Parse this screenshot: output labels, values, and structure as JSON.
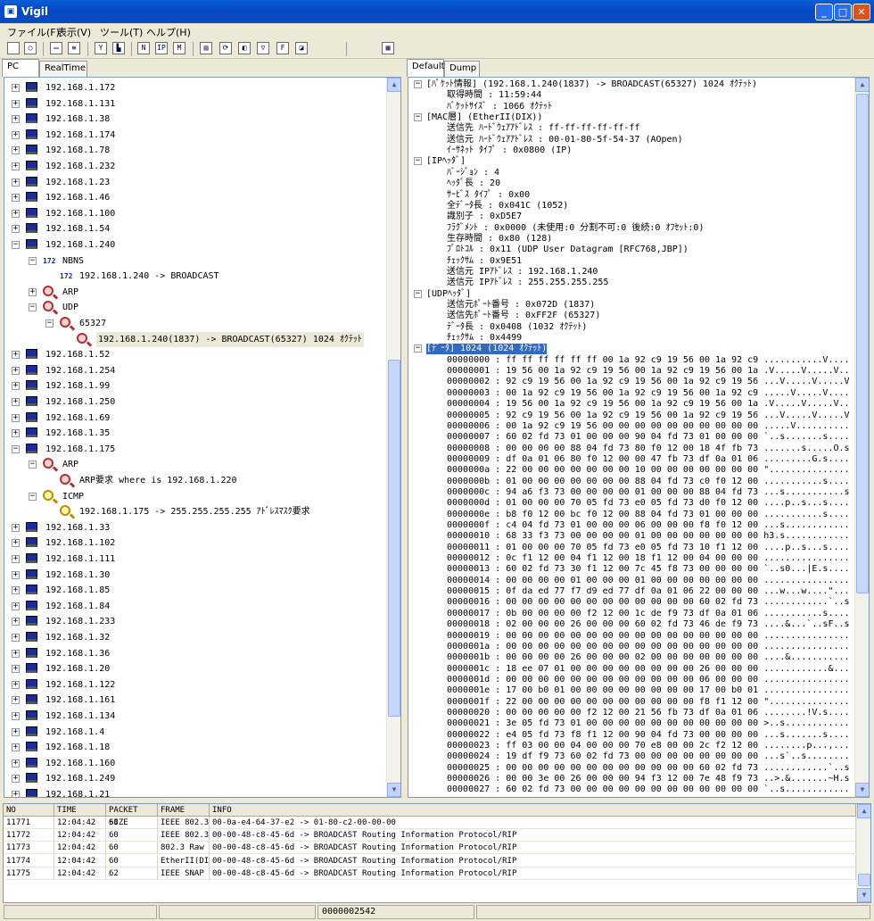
{
  "window": {
    "title": "Vigil",
    "app_icon": "computer-icon"
  },
  "menu": [
    "ファイル(F)",
    "表示(V)",
    "ツール(T)",
    "ヘルプ(H)"
  ],
  "left_tabs": [
    "PC",
    "RealTime"
  ],
  "right_tabs": [
    "Default",
    "Dump"
  ],
  "tree": [
    {
      "text": "192.168.1.172",
      "lv": 0,
      "t": "pc",
      "e": "+"
    },
    {
      "text": "192.168.1.131",
      "lv": 0,
      "t": "pc",
      "e": "+"
    },
    {
      "text": "192.168.1.38",
      "lv": 0,
      "t": "pc",
      "e": "+"
    },
    {
      "text": "192.168.1.174",
      "lv": 0,
      "t": "pc",
      "e": "+"
    },
    {
      "text": "192.168.1.78",
      "lv": 0,
      "t": "pc",
      "e": "+"
    },
    {
      "text": "192.168.1.232",
      "lv": 0,
      "t": "pc",
      "e": "+"
    },
    {
      "text": "192.168.1.23",
      "lv": 0,
      "t": "pc",
      "e": "+"
    },
    {
      "text": "192.168.1.46",
      "lv": 0,
      "t": "pc",
      "e": "+"
    },
    {
      "text": "192.168.1.100",
      "lv": 0,
      "t": "pc",
      "e": "+"
    },
    {
      "text": "192.168.1.54",
      "lv": 0,
      "t": "pc",
      "e": "+"
    },
    {
      "text": "192.168.1.240",
      "lv": 0,
      "t": "pc",
      "e": "-"
    },
    {
      "text": "NBNS",
      "lv": 1,
      "t": "nb",
      "e": "-"
    },
    {
      "text": "192.168.1.240 -> BROADCAST",
      "lv": 2,
      "t": "nb",
      "e": ""
    },
    {
      "text": "ARP",
      "lv": 1,
      "t": "mag",
      "e": "+"
    },
    {
      "text": "UDP",
      "lv": 1,
      "t": "mag",
      "e": "-"
    },
    {
      "text": "65327",
      "lv": 2,
      "t": "mag",
      "e": "-"
    },
    {
      "text": "192.168.1.240(1837) -> BROADCAST(65327) 1024 ｵｸﾃｯﾄ",
      "lv": 3,
      "t": "mag",
      "e": "",
      "sel": true
    },
    {
      "text": "192.168.1.52",
      "lv": 0,
      "t": "pc",
      "e": "+"
    },
    {
      "text": "192.168.1.254",
      "lv": 0,
      "t": "pc",
      "e": "+"
    },
    {
      "text": "192.168.1.99",
      "lv": 0,
      "t": "pc",
      "e": "+"
    },
    {
      "text": "192.168.1.250",
      "lv": 0,
      "t": "pc",
      "e": "+"
    },
    {
      "text": "192.168.1.69",
      "lv": 0,
      "t": "pc",
      "e": "+"
    },
    {
      "text": "192.168.1.35",
      "lv": 0,
      "t": "pc",
      "e": "+"
    },
    {
      "text": "192.168.1.175",
      "lv": 0,
      "t": "pc",
      "e": "-"
    },
    {
      "text": "ARP",
      "lv": 1,
      "t": "mag",
      "e": "-"
    },
    {
      "text": "ARP要求 where is 192.168.1.220",
      "lv": 2,
      "t": "mag",
      "e": ""
    },
    {
      "text": "ICMP",
      "lv": 1,
      "t": "magy",
      "e": "-"
    },
    {
      "text": "192.168.1.175 -> 255.255.255.255 ｱﾄﾞﾚｽﾏｽｸ要求",
      "lv": 2,
      "t": "magy",
      "e": ""
    },
    {
      "text": "192.168.1.33",
      "lv": 0,
      "t": "pc",
      "e": "+"
    },
    {
      "text": "192.168.1.102",
      "lv": 0,
      "t": "pc",
      "e": "+"
    },
    {
      "text": "192.168.1.111",
      "lv": 0,
      "t": "pc",
      "e": "+"
    },
    {
      "text": "192.168.1.30",
      "lv": 0,
      "t": "pc",
      "e": "+"
    },
    {
      "text": "192.168.1.85",
      "lv": 0,
      "t": "pc",
      "e": "+"
    },
    {
      "text": "192.168.1.84",
      "lv": 0,
      "t": "pc",
      "e": "+"
    },
    {
      "text": "192.168.1.233",
      "lv": 0,
      "t": "pc",
      "e": "+"
    },
    {
      "text": "192.168.1.32",
      "lv": 0,
      "t": "pc",
      "e": "+"
    },
    {
      "text": "192.168.1.36",
      "lv": 0,
      "t": "pc",
      "e": "+"
    },
    {
      "text": "192.168.1.20",
      "lv": 0,
      "t": "pc",
      "e": "+"
    },
    {
      "text": "192.168.1.122",
      "lv": 0,
      "t": "pc",
      "e": "+"
    },
    {
      "text": "192.168.1.161",
      "lv": 0,
      "t": "pc",
      "e": "+"
    },
    {
      "text": "192.168.1.134",
      "lv": 0,
      "t": "pc",
      "e": "+"
    },
    {
      "text": "192.168.1.4",
      "lv": 0,
      "t": "pc",
      "e": "+"
    },
    {
      "text": "192.168.1.18",
      "lv": 0,
      "t": "pc",
      "e": "+"
    },
    {
      "text": "192.168.1.160",
      "lv": 0,
      "t": "pc",
      "e": "+"
    },
    {
      "text": "192.168.1.249",
      "lv": 0,
      "t": "pc",
      "e": "+"
    },
    {
      "text": "192.168.1.21",
      "lv": 0,
      "t": "pc",
      "e": "+"
    }
  ],
  "detail": [
    {
      "text": "[ﾊﾟｹｯﾄ情報] (192.168.1.240(1837) -> BROADCAST(65327) 1024 ｵｸﾃｯﾄ)",
      "lv": 0,
      "e": "-"
    },
    {
      "text": "取得時間 : 11:59:44",
      "lv": 1,
      "e": ""
    },
    {
      "text": "ﾊﾟｹｯﾄｻｲｽﾞ : 1066 ｵｸﾃｯﾄ",
      "lv": 1,
      "e": ""
    },
    {
      "text": "[MAC層] (EtherII(DIX))",
      "lv": 0,
      "e": "-"
    },
    {
      "text": "送信先 ﾊｰﾄﾞｳｪｱｱﾄﾞﾚｽ : ff-ff-ff-ff-ff-ff",
      "lv": 1,
      "e": ""
    },
    {
      "text": "送信元 ﾊｰﾄﾞｳｪｱｱﾄﾞﾚｽ : 00-01-80-5f-54-37 (AOpen)",
      "lv": 1,
      "e": ""
    },
    {
      "text": "ｲｰｻﾈｯﾄ ﾀｲﾌﾟ : 0x0800 (IP)",
      "lv": 1,
      "e": ""
    },
    {
      "text": "[IPﾍｯﾀﾞ]",
      "lv": 0,
      "e": "-"
    },
    {
      "text": "ﾊﾞｰｼﾞｮﾝ : 4",
      "lv": 1,
      "e": ""
    },
    {
      "text": "ﾍｯﾀﾞ長 : 20",
      "lv": 1,
      "e": ""
    },
    {
      "text": "ｻｰﾋﾞｽ ﾀｲﾌﾟ : 0x00",
      "lv": 1,
      "e": ""
    },
    {
      "text": "全ﾃﾞｰﾀ長 : 0x041C (1052)",
      "lv": 1,
      "e": ""
    },
    {
      "text": "識別子 : 0xD5E7",
      "lv": 1,
      "e": ""
    },
    {
      "text": "ﾌﾗｸﾞﾒﾝﾄ : 0x0000 (未使用:0 分割不可:0 後続:0 ｵﾌｾｯﾄ:0)",
      "lv": 1,
      "e": ""
    },
    {
      "text": "生存時間 : 0x80 (128)",
      "lv": 1,
      "e": ""
    },
    {
      "text": "ﾌﾟﾛﾄｺﾙ : 0x11 (UDP User Datagram [RFC768,JBP])",
      "lv": 1,
      "e": ""
    },
    {
      "text": "ﾁｪｯｸｻﾑ : 0x9E51",
      "lv": 1,
      "e": ""
    },
    {
      "text": "送信元 IPｱﾄﾞﾚｽ : 192.168.1.240",
      "lv": 1,
      "e": ""
    },
    {
      "text": "送信元 IPｱﾄﾞﾚｽ : 255.255.255.255",
      "lv": 1,
      "e": ""
    },
    {
      "text": "[UDPﾍｯﾀﾞ]",
      "lv": 0,
      "e": "-"
    },
    {
      "text": "送信元ﾎﾟｰﾄ番号 : 0x072D (1837)",
      "lv": 1,
      "e": ""
    },
    {
      "text": "送信先ﾎﾟｰﾄ番号 : 0xFF2F (65327)",
      "lv": 1,
      "e": ""
    },
    {
      "text": "ﾃﾞｰﾀ長 : 0x0408 (1032 ｵｸﾃｯﾄ)",
      "lv": 1,
      "e": ""
    },
    {
      "text": "ﾁｪｯｸｻﾑ : 0x4499",
      "lv": 1,
      "e": ""
    },
    {
      "text": "[ﾃﾞｰﾀ] 1024 (1024 ｵｸﾃｯﾄ)",
      "lv": 0,
      "e": "-",
      "sel": true
    },
    {
      "text": "00000000 : ff ff ff ff ff ff 00 1a 92 c9 19 56 00 1a 92 c9 ...........V....",
      "lv": 1,
      "e": ""
    },
    {
      "text": "00000001 : 19 56 00 1a 92 c9 19 56 00 1a 92 c9 19 56 00 1a .V.....V.....V..",
      "lv": 1,
      "e": ""
    },
    {
      "text": "00000002 : 92 c9 19 56 00 1a 92 c9 19 56 00 1a 92 c9 19 56 ...V.....V.....V",
      "lv": 1,
      "e": ""
    },
    {
      "text": "00000003 : 00 1a 92 c9 19 56 00 1a 92 c9 19 56 00 1a 92 c9 .....V.....V....",
      "lv": 1,
      "e": ""
    },
    {
      "text": "00000004 : 19 56 00 1a 92 c9 19 56 00 1a 92 c9 19 56 00 1a .V.....V.....V..",
      "lv": 1,
      "e": ""
    },
    {
      "text": "00000005 : 92 c9 19 56 00 1a 92 c9 19 56 00 1a 92 c9 19 56 ...V.....V.....V",
      "lv": 1,
      "e": ""
    },
    {
      "text": "00000006 : 00 1a 92 c9 19 56 00 00 00 00 00 00 00 00 00 00 .....V..........",
      "lv": 1,
      "e": ""
    },
    {
      "text": "00000007 : 60 02 fd 73 01 00 00 00 90 04 fd 73 01 00 00 00 `..s.......s....",
      "lv": 1,
      "e": ""
    },
    {
      "text": "00000008 : 00 00 00 00 88 04 fd 73 80 f0 12 00 18 4f fb 73 .......s.....O.s",
      "lv": 1,
      "e": ""
    },
    {
      "text": "00000009 : df 0a 01 06 80 f0 12 00 00 47 fb 73 df 0a 01 06 .........G.s....",
      "lv": 1,
      "e": ""
    },
    {
      "text": "0000000a : 22 00 00 00 00 00 00 00 10 00 00 00 00 00 00 00 \"...............",
      "lv": 1,
      "e": ""
    },
    {
      "text": "0000000b : 01 00 00 00 00 00 00 00 88 04 fd 73 c0 f0 12 00 ...........s....",
      "lv": 1,
      "e": ""
    },
    {
      "text": "0000000c : 94 a6 f3 73 00 00 00 00 01 00 00 00 88 04 fd 73 ...s...........s",
      "lv": 1,
      "e": ""
    },
    {
      "text": "0000000d : 01 00 00 00 70 05 fd 73 e0 05 fd 73 d0 f0 12 00 ....p..s...s....",
      "lv": 1,
      "e": ""
    },
    {
      "text": "0000000e : b8 f0 12 00 bc f0 12 00 88 04 fd 73 01 00 00 00 ...........s....",
      "lv": 1,
      "e": ""
    },
    {
      "text": "0000000f : c4 04 fd 73 01 00 00 00 06 00 00 00 f8 f0 12 00 ...s............",
      "lv": 1,
      "e": ""
    },
    {
      "text": "00000010 : 68 33 f3 73 00 00 00 00 01 00 00 00 00 00 00 00 h3.s............",
      "lv": 1,
      "e": ""
    },
    {
      "text": "00000011 : 01 00 00 00 70 05 fd 73 e0 05 fd 73 10 f1 12 00 ....p..s...s....",
      "lv": 1,
      "e": ""
    },
    {
      "text": "00000012 : 0c f1 12 00 04 f1 12 00 18 f1 12 00 04 00 00 00 ................",
      "lv": 1,
      "e": ""
    },
    {
      "text": "00000013 : 60 02 fd 73 30 f1 12 00 7c 45 f8 73 00 00 00 00 `..s0...|E.s....",
      "lv": 1,
      "e": ""
    },
    {
      "text": "00000014 : 00 00 00 00 01 00 00 00 01 00 00 00 00 00 00 00 ................",
      "lv": 1,
      "e": ""
    },
    {
      "text": "00000015 : 0f da ed 77 f7 d9 ed 77 df 0a 01 06 22 00 00 00 ...w...w....\"...",
      "lv": 1,
      "e": ""
    },
    {
      "text": "00000016 : 00 00 00 00 00 00 00 00 00 00 00 00 60 02 fd 73 ............`..s",
      "lv": 1,
      "e": ""
    },
    {
      "text": "00000017 : 0b 00 00 00 00 f2 12 00 1c de f9 73 df 0a 01 06 ...........s....",
      "lv": 1,
      "e": ""
    },
    {
      "text": "00000018 : 02 00 00 00 26 00 00 00 60 02 fd 73 46 de f9 73 ....&...`..sF..s",
      "lv": 1,
      "e": ""
    },
    {
      "text": "00000019 : 00 00 00 00 00 00 00 00 00 00 00 00 00 00 00 00 ................",
      "lv": 1,
      "e": ""
    },
    {
      "text": "0000001a : 00 00 00 00 00 00 00 00 00 00 00 00 00 00 00 00 ................",
      "lv": 1,
      "e": ""
    },
    {
      "text": "0000001b : 00 00 00 00 26 00 00 00 02 00 00 00 00 00 00 00 ....&...........",
      "lv": 1,
      "e": ""
    },
    {
      "text": "0000001c : 18 ee 07 01 00 00 00 00 00 00 00 00 26 00 00 00 ............&...",
      "lv": 1,
      "e": ""
    },
    {
      "text": "0000001d : 00 00 00 00 00 00 00 00 00 00 00 00 06 00 00 00 ................",
      "lv": 1,
      "e": ""
    },
    {
      "text": "0000001e : 17 00 b0 01 00 00 00 00 00 00 00 00 17 00 b0 01 ................",
      "lv": 1,
      "e": ""
    },
    {
      "text": "0000001f : 22 00 00 00 00 00 00 00 00 00 00 00 f8 f1 12 00 \"...............",
      "lv": 1,
      "e": ""
    },
    {
      "text": "00000020 : 00 00 00 00 00 f2 12 00 21 56 fb 73 df 0a 01 06 ........!V.s....",
      "lv": 1,
      "e": ""
    },
    {
      "text": "00000021 : 3e 05 fd 73 01 00 00 00 00 00 00 00 00 00 00 00 >..s............",
      "lv": 1,
      "e": ""
    },
    {
      "text": "00000022 : e4 05 fd 73 f8 f1 12 00 90 04 fd 73 00 00 00 00 ...s.......s....",
      "lv": 1,
      "e": ""
    },
    {
      "text": "00000023 : ff 03 00 00 04 00 00 00 70 e8 00 00 2c f2 12 00 ........p...,...",
      "lv": 1,
      "e": ""
    },
    {
      "text": "00000024 : 19 df f9 73 60 02 fd 73 00 00 00 00 00 00 00 00 ...s`..s........",
      "lv": 1,
      "e": ""
    },
    {
      "text": "00000025 : 00 00 00 00 00 00 00 00 00 00 00 00 60 02 fd 73 ............`..s",
      "lv": 1,
      "e": ""
    },
    {
      "text": "00000026 : 00 00 3e 00 26 00 00 00 94 f3 12 00 7e 48 f9 73 ..>.&.......~H.s",
      "lv": 1,
      "e": ""
    },
    {
      "text": "00000027 : 60 02 fd 73 00 00 00 00 00 00 00 00 00 00 00 00 `..s............",
      "lv": 1,
      "e": ""
    }
  ],
  "packets": {
    "columns": [
      "NO",
      "TIME",
      "PACKET SIZE",
      "FRAME",
      "INFO"
    ],
    "rows": [
      [
        "11771",
        "12:04:42",
        "60",
        "IEEE 802.3",
        "00-0a-e4-64-37-e2 -> 01-80-c2-00-00-00"
      ],
      [
        "11772",
        "12:04:42",
        "60",
        "IEEE 802.3",
        "00-00-48-c8-45-6d -> BROADCAST Routing Information Protocol/RIP"
      ],
      [
        "11773",
        "12:04:42",
        "60",
        "802.3 Raw",
        "00-00-48-c8-45-6d -> BROADCAST Routing Information Protocol/RIP"
      ],
      [
        "11774",
        "12:04:42",
        "60",
        "EtherII(DIX)",
        "00-00-48-c8-45-6d -> BROADCAST Routing Information Protocol/RIP"
      ],
      [
        "11775",
        "12:04:42",
        "62",
        "IEEE SNAP",
        "00-00-48-c8-45-6d -> BROADCAST Routing Information Protocol/RIP"
      ]
    ]
  },
  "status": {
    "count": "0000002542"
  },
  "colors": {
    "title_bar": "#0548c8",
    "selection": "#316ac5",
    "node_highlight": "#ece9d8"
  }
}
